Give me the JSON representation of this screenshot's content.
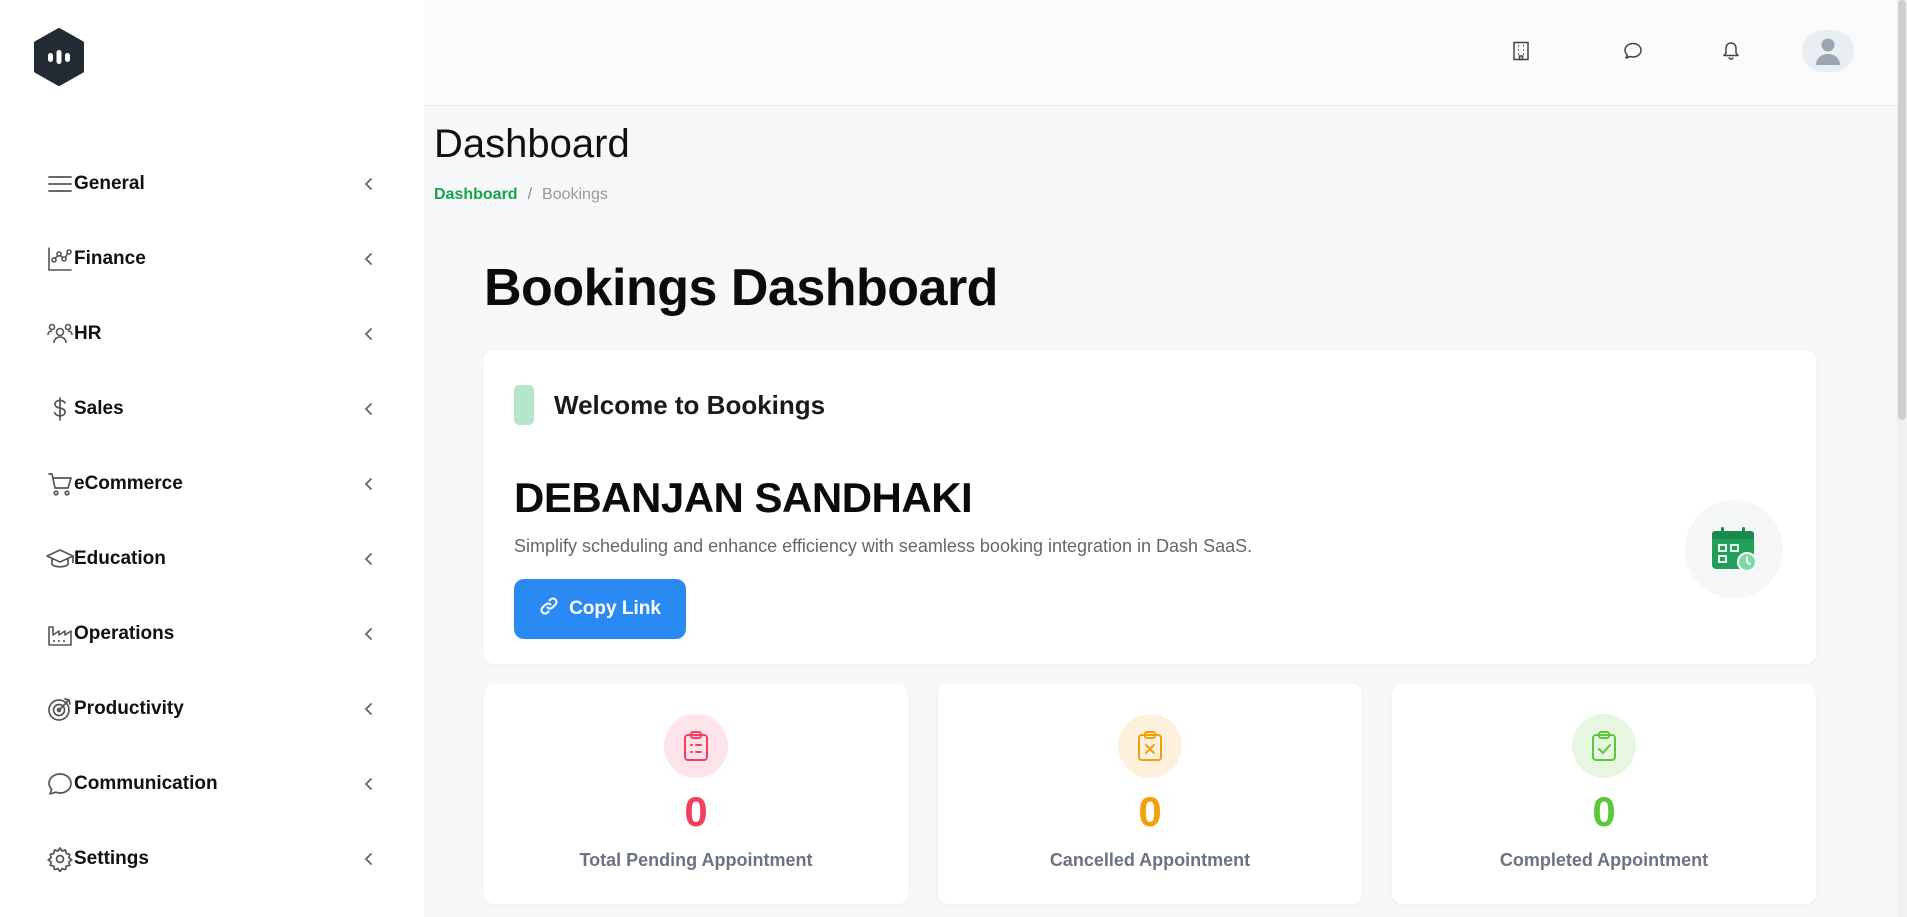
{
  "sidebar": {
    "logo_icon": "app-logo-icon",
    "items": [
      {
        "label": "General",
        "icon": "menu-lines-icon"
      },
      {
        "label": "Finance",
        "icon": "finance-chart-icon"
      },
      {
        "label": "HR",
        "icon": "people-icon"
      },
      {
        "label": "Sales",
        "icon": "dollar-icon"
      },
      {
        "label": "eCommerce",
        "icon": "cart-icon"
      },
      {
        "label": "Education",
        "icon": "graduation-cap-icon"
      },
      {
        "label": "Operations",
        "icon": "factory-icon"
      },
      {
        "label": "Productivity",
        "icon": "target-icon"
      },
      {
        "label": "Communication",
        "icon": "chat-bubble-icon"
      },
      {
        "label": "Settings",
        "icon": "gear-icon"
      }
    ]
  },
  "topbar": {
    "icons": [
      "building-icon",
      "chat-icon",
      "bell-icon",
      "user-avatar-icon"
    ]
  },
  "page": {
    "title": "Dashboard",
    "breadcrumb": {
      "active": "Dashboard",
      "separator": "/",
      "current": "Bookings"
    }
  },
  "main": {
    "heading": "Bookings Dashboard",
    "welcome": {
      "title": "Welcome to Bookings",
      "user_name": "DEBANJAN SANDHAKI",
      "description": "Simplify scheduling and enhance efficiency with seamless booking integration in Dash SaaS.",
      "button_label": "Copy Link"
    },
    "stats": [
      {
        "value": "0",
        "label": "Total Pending Appointment",
        "color": "#f43f5e",
        "bg": "#fde4ea"
      },
      {
        "value": "0",
        "label": "Cancelled Appointment",
        "color": "#f59e0b",
        "bg": "#fdf0dc"
      },
      {
        "value": "0",
        "label": "Completed Appointment",
        "color": "#5ac83a",
        "bg": "#e6f6e1"
      }
    ]
  },
  "colors": {
    "accent_green": "#16a34a",
    "button_blue": "#2b89f4"
  }
}
